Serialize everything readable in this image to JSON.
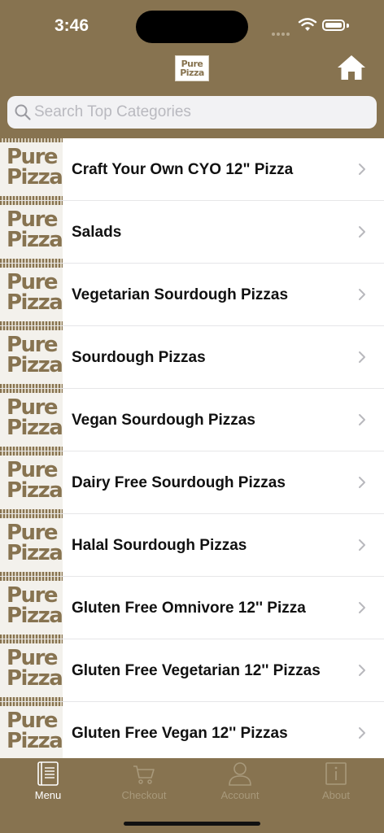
{
  "status": {
    "time": "3:46"
  },
  "header": {
    "logo_line1": "Pure",
    "logo_line2": "Pizza"
  },
  "search": {
    "placeholder": "Search Top Categories",
    "value": ""
  },
  "thumb": {
    "line1": "Pure",
    "line2": "Pizza"
  },
  "categories": [
    {
      "label": "Craft Your Own CYO 12\" Pizza"
    },
    {
      "label": "Salads"
    },
    {
      "label": "Vegetarian Sourdough Pizzas"
    },
    {
      "label": "Sourdough Pizzas"
    },
    {
      "label": "Vegan Sourdough Pizzas"
    },
    {
      "label": "Dairy Free Sourdough Pizzas"
    },
    {
      "label": "Halal Sourdough Pizzas"
    },
    {
      "label": "Gluten Free Omnivore 12'' Pizza"
    },
    {
      "label": "Gluten Free Vegetarian 12'' Pizzas"
    },
    {
      "label": "Gluten Free Vegan 12'' Pizzas"
    }
  ],
  "tabs": [
    {
      "label": "Menu",
      "icon": "menu-book-icon",
      "active": true
    },
    {
      "label": "Checkout",
      "icon": "cart-icon",
      "active": false
    },
    {
      "label": "Account",
      "icon": "person-icon",
      "active": false
    },
    {
      "label": "About",
      "icon": "info-icon",
      "active": false
    }
  ],
  "colors": {
    "brand": "#877350",
    "tab_inactive": "#a8997b",
    "tab_active": "#ffffff"
  }
}
